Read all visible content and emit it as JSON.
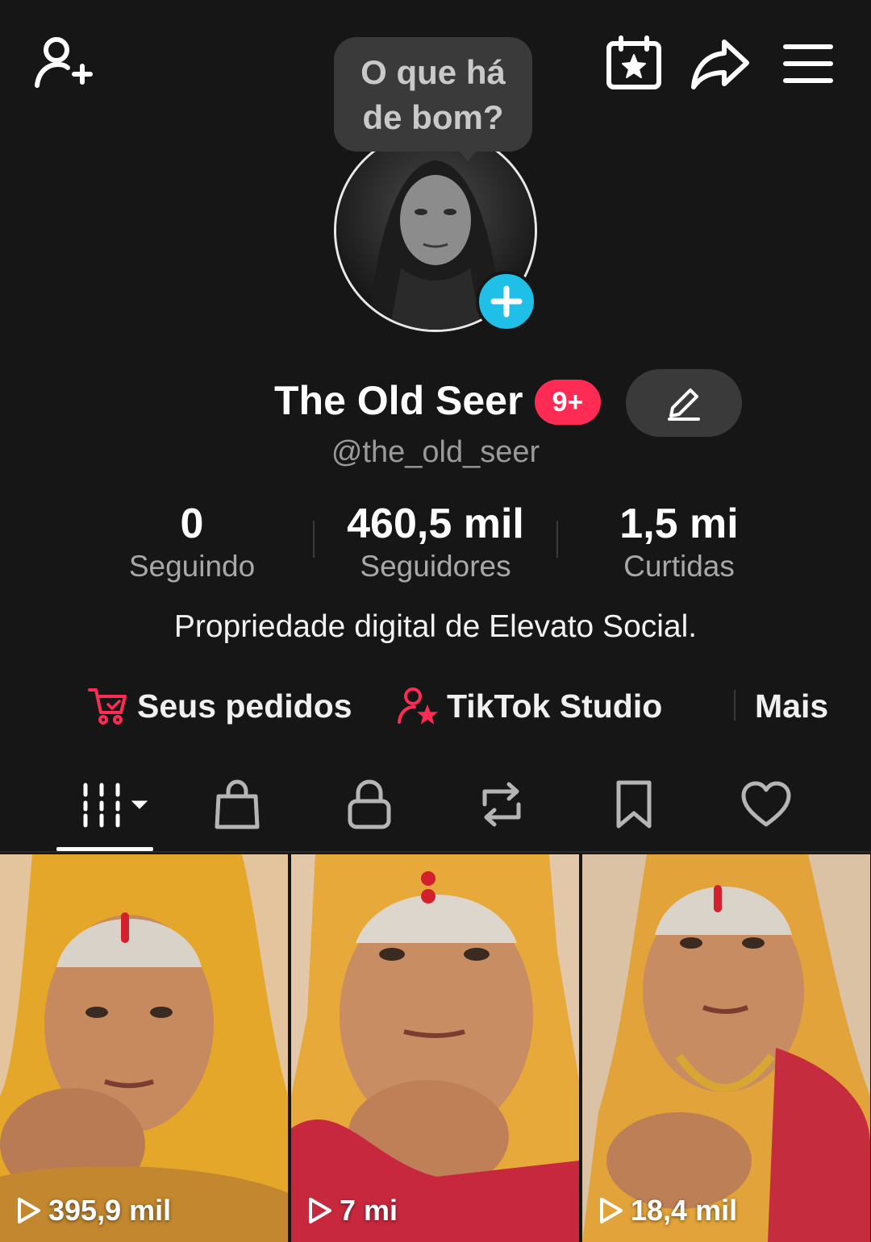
{
  "header": {
    "icons": [
      "add-friend-icon",
      "calendar-star-icon",
      "share-arrow-icon",
      "hamburger-menu-icon"
    ]
  },
  "story_bubble": {
    "line1": "O que há",
    "line2": "de bom?"
  },
  "profile": {
    "display_name": "The Old Seer",
    "notification_badge": "9+",
    "username": "@the_old_seer",
    "bio": "Propriedade digital de Elevato Social."
  },
  "stats": {
    "following": {
      "value": "0",
      "label": "Seguindo"
    },
    "followers": {
      "value": "460,5 mil",
      "label": "Seguidores"
    },
    "likes": {
      "value": "1,5 mi",
      "label": "Curtidas"
    }
  },
  "quick_links": {
    "orders": "Seus pedidos",
    "studio": "TikTok Studio",
    "more": "Mais"
  },
  "tabs": [
    "videos-grid-icon",
    "shop-bag-icon",
    "lock-icon",
    "repost-icon",
    "bookmark-icon",
    "heart-icon"
  ],
  "videos": [
    {
      "views": "395,9 mil"
    },
    {
      "views": "7 mi"
    },
    {
      "views": "18,4 mil"
    }
  ],
  "colors": {
    "background": "#161616",
    "accent_red": "#fe2c55",
    "accent_cyan": "#20bfe8",
    "muted_text": "#a8a8a8"
  }
}
